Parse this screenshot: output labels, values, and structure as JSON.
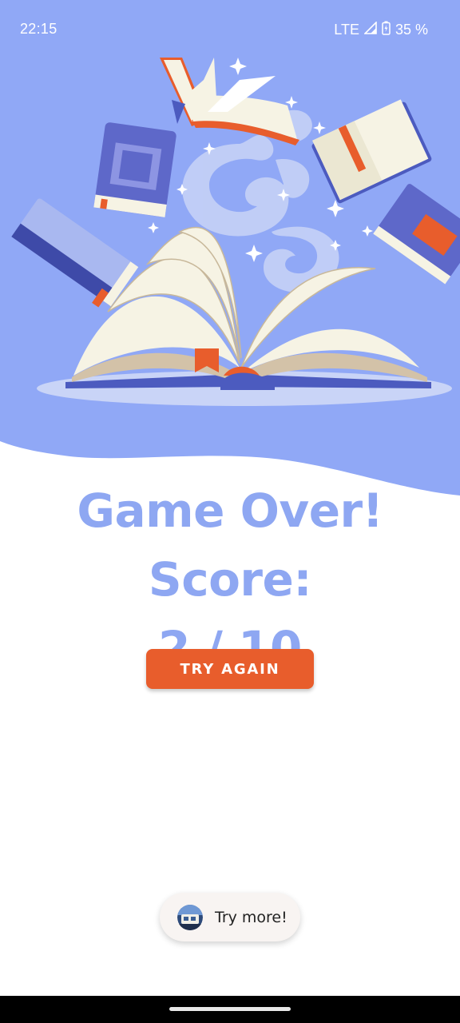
{
  "status_bar": {
    "time": "22:15",
    "network": "LTE",
    "battery": "35 %",
    "icons": [
      "signal-icon",
      "battery-charging-icon"
    ]
  },
  "game_over": {
    "title": "Game Over! Score:",
    "score": "2 / 10"
  },
  "actions": {
    "try_again_label": "TRY AGAIN"
  },
  "toast": {
    "text": "Try more!",
    "icon": "app-thumbnail-icon"
  },
  "colors": {
    "hero_background": "#90a8f6",
    "title": "#8ea7f2",
    "button": "#e85d2c",
    "toast_background": "#f8f4f2"
  }
}
